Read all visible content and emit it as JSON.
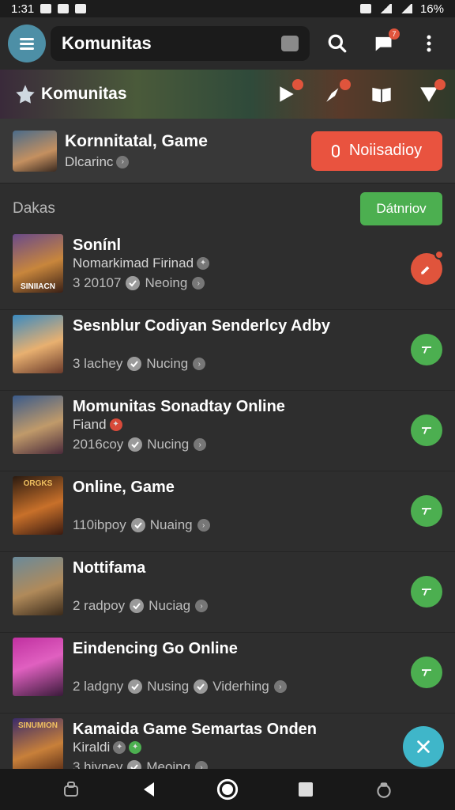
{
  "status_bar": {
    "time": "1:31",
    "battery": "16%"
  },
  "top_bar": {
    "title": "Komunitas",
    "notification_count": "7"
  },
  "banner": {
    "title": "Komunitas"
  },
  "community": {
    "name": "Kornnitatal, Game",
    "subtitle": "Dlcarinc",
    "join_label": "Noiisadioy"
  },
  "section": {
    "label": "Dakas",
    "button_label": "Dátnriov"
  },
  "items": [
    {
      "title": "Sonínl",
      "line2": "Nomarkimad Firinad",
      "meta1": "3 20107",
      "meta2": "Neoing",
      "action": "red"
    },
    {
      "title": "Sesnblur Codiyan Senderlcy Adby",
      "line2": "",
      "meta1": "3 lachey",
      "meta2": "Nucing",
      "action": "green"
    },
    {
      "title": "Momunitas Sonadtay Online",
      "line2": "Fiand",
      "meta1": "2016coy",
      "meta2": "Nucing",
      "action": "green"
    },
    {
      "title": "Online, Game",
      "line2": "",
      "meta1": "110ibpoy",
      "meta2": "Nuaing",
      "action": "green"
    },
    {
      "title": "Nottifama",
      "line2": "",
      "meta1": "2 radpoy",
      "meta2": "Nuciag",
      "action": "green"
    },
    {
      "title": "Eindencing Go Online",
      "line2": "",
      "meta1": "2 ladgny",
      "meta2": "Nusing",
      "meta3": "Viderhing",
      "action": "green"
    },
    {
      "title": "Kamaida Game Semartas Onden",
      "line2": "Kiraldi",
      "meta1": "3 hiyney",
      "meta2": "Meoing",
      "action": "none"
    }
  ],
  "thumb_captions": [
    "SINIIACN",
    "",
    "",
    "ORGKS",
    "",
    "",
    "SINUMION"
  ],
  "colors": {
    "accent_green": "#4caf50",
    "accent_red": "#e9533f",
    "fab": "#3fb6c9"
  }
}
